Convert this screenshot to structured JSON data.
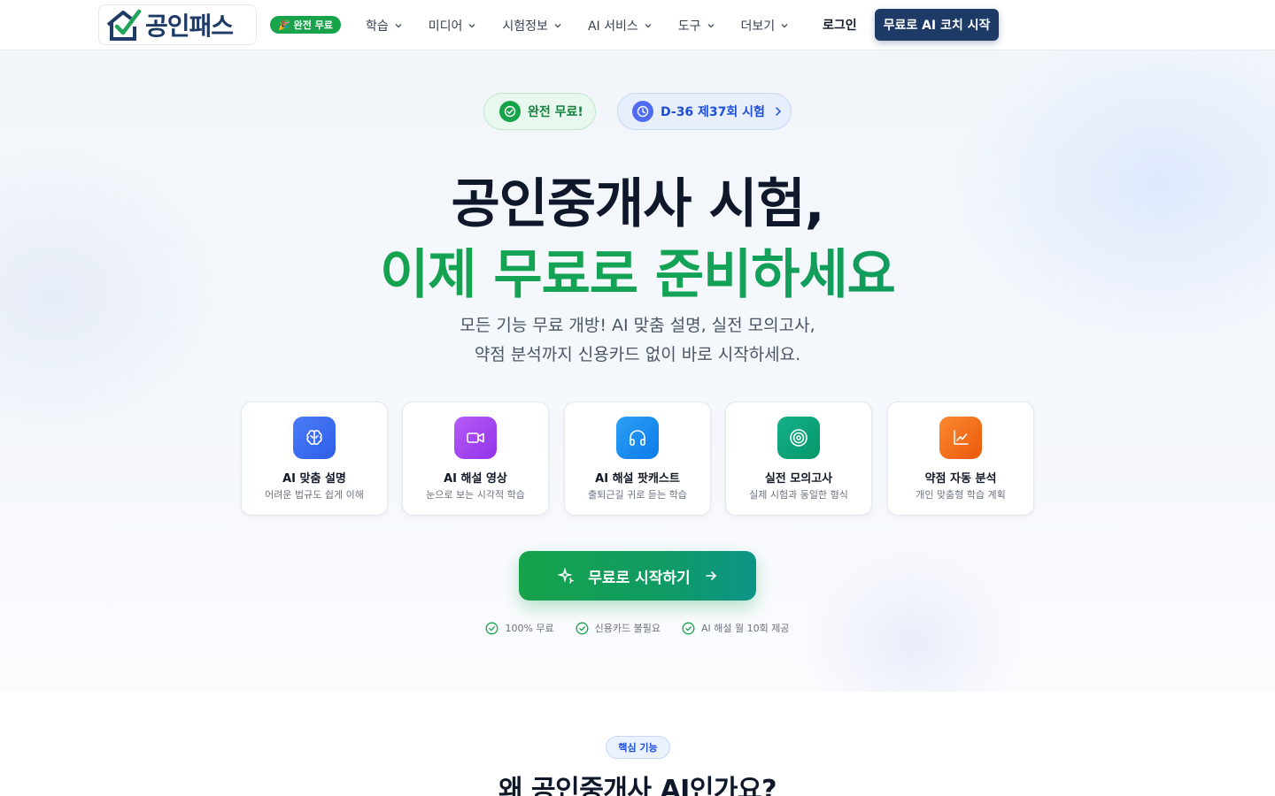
{
  "header": {
    "logo_text": "공인패스",
    "free_badge": "🎉 완전 무료",
    "nav": [
      {
        "label": "학습"
      },
      {
        "label": "미디어"
      },
      {
        "label": "시험정보"
      },
      {
        "label": "AI 서비스"
      },
      {
        "label": "도구"
      },
      {
        "label": "더보기"
      }
    ],
    "login": "로그인",
    "cta": "무료로 AI 코치 시작"
  },
  "badges": {
    "free": "완전 무료!",
    "dday": "D-36 제37회 시험"
  },
  "hero": {
    "title_line1": "공인중개사 시험,",
    "title_line2": "이제 무료로 준비하세요",
    "subtitle_line1": "모든 기능 무료 개방! AI 맞춤 설명, 실전 모의고사,",
    "subtitle_line2": "약점 분석까지 신용카드 없이 바로 시작하세요."
  },
  "features": [
    {
      "title": "AI 맞춤 설명",
      "desc": "어려운 법규도 쉽게 이해",
      "icon": "brain-icon",
      "color": "#3b6df0"
    },
    {
      "title": "AI 해설 영상",
      "desc": "눈으로 보는 시각적 학습",
      "icon": "video-icon",
      "color": "#a54df0"
    },
    {
      "title": "AI 해설 팟캐스트",
      "desc": "출퇴근길 귀로 듣는 학습",
      "icon": "headphones-icon",
      "color": "#1d8ff2"
    },
    {
      "title": "실전 모의고사",
      "desc": "실제 시험과 동일한 형식",
      "icon": "target-icon",
      "color": "#10a37f"
    },
    {
      "title": "약점 자동 분석",
      "desc": "개인 맞춤형 학습 계획",
      "icon": "chart-icon",
      "color": "#f97316"
    }
  ],
  "cta_main": "무료로 시작하기",
  "checks": [
    "100% 무료",
    "신용카드 불필요",
    "AI 해설 월 10회 제공"
  ],
  "section": {
    "badge": "핵심 기능",
    "title": "왜 공인중개사 AI인가요?"
  },
  "colors": {
    "brand_navy": "#1e3a66",
    "brand_green": "#16a34a",
    "accent_blue": "#1d4ed8"
  }
}
